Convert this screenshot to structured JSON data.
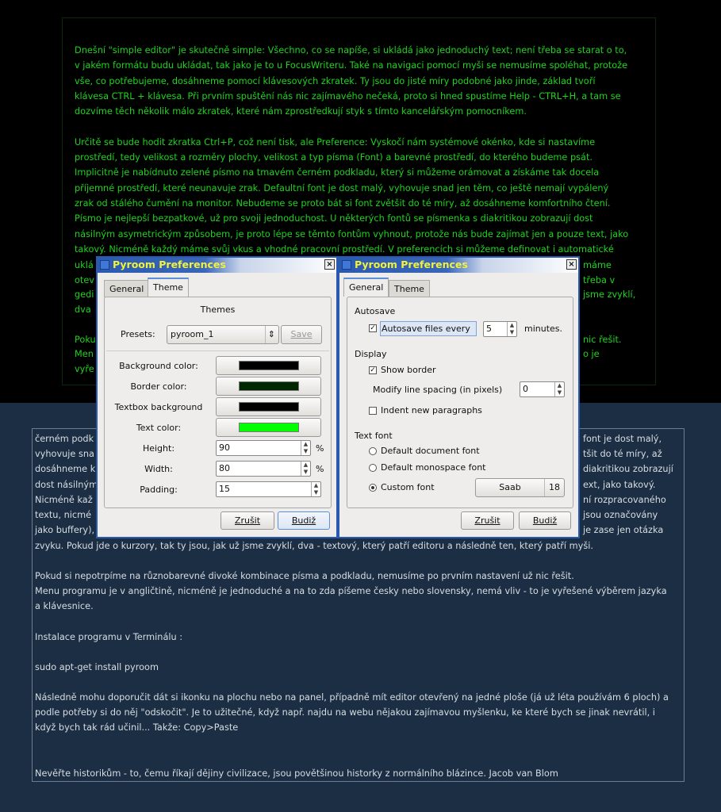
{
  "editor_top": {
    "lines": [
      "Dnešní \"simple editor\" je skutečně simple: Všechno, co se napíše, si ukládá jako jednoduchý text; není třeba se starat o to,",
      "v jakém formátu budu ukládat, tak jako je to u FocusWriteru. Také na navigaci pomocí myši se nemusíme spoléhat, protože",
      "vše, co potřebujeme, dosáhneme pomocí klávesových zkratek. Ty jsou do jisté míry podobné jako jinde, základ tvoří",
      "klávesa CTRL + klávesa. Při prvním spuštění nás nic zajímavého nečeká, proto si hned spustíme Help - CTRL+H, a tam se",
      "dozvíme těch několik málo zkratek, které nám zprostředkují styk s tímto kancelářským pomocníkem.",
      "",
      "Určitě se bude hodit zkratka Ctrl+P, což není tisk, ale Preference: Vyskočí nám systémové okénko, kde si nastavíme",
      "prostředí, tedy velikost a rozměry plochy, velikost a typ písma (Font) a barevné prostředí, do kterého budeme psát.",
      "Implicitně je nabídnuto zelené písmo na tmavém černém podkladu, který si můžeme orámovat a získáme tak docela",
      "příjemné prostředí, které neunavuje zrak. Defaultní font je dost malý, vyhovuje snad jen těm, co ještě nemají vypálený",
      "zrak od stálého čumění na monitor. Nebudeme se proto bát si font zvětšit do té míry, až dosáhneme komfortního čtení.",
      "Písmo je nejlepší bezpatkové, už pro svoji jednoduchost. U některých fontů se písmenka s diakritikou zobrazují dost",
      "násilným asymetrickým způsobem, je proto lépe se těmto fontům vyhnout, protože nás bude zajímat jen a pouze text, jako",
      "takový. Nicméně každý máme svůj vkus a vhodné pracovní prostředí. V preferencích si můžeme definovat i automatické"
    ],
    "partial_lines": [
      {
        "left": "uklá",
        "right": "máme"
      },
      {
        "left": "otev",
        "right": "třeba v"
      },
      {
        "left": "gedi",
        "right": "jsme zvyklí,"
      },
      {
        "left": "dva",
        "right": ""
      },
      {
        "left": "",
        "right": ""
      },
      {
        "left": "Poku",
        "right": "nic řešit."
      },
      {
        "left": "Men",
        "right": "o je"
      },
      {
        "left": "vyře",
        "right": ""
      }
    ]
  },
  "editor_bottom": {
    "partial_lines": [
      {
        "left": "černém podk",
        "right": "font je dost malý,"
      },
      {
        "left": "vyhovuje sna",
        "right": "tšit do té míry, až"
      },
      {
        "left": "dosáhneme k",
        "right": "diakritikou zobrazují"
      },
      {
        "left": "dost násilným",
        "right": "ext, jako takový."
      },
      {
        "left": "Nicméně kaž",
        "right": "ní rozpracovaného"
      },
      {
        "left": "textu, nicmé",
        "right": "jsou označovány"
      },
      {
        "left": "jako buffery),",
        "right": "je zase jen otázka"
      }
    ],
    "lines": [
      "zvyku. Pokud jde o kurzory, tak ty jsou, jak už jsme zvyklí, dva - textový, který patří editoru a následně ten, který patří myši.",
      "",
      "Pokud si nepotrpíme na různobarevné divoké kombinace písma a podkladu, nemusíme po prvním nastavení už nic řešit.",
      "Menu programu je v angličtině, nicméně je jednoduché a na to zda píšeme česky nebo slovensky, nemá vliv - to je vyřešené výběrem jazyka",
      "a klávesnice.",
      "",
      "Instalace programu v Terminálu :",
      "",
      "sudo apt-get install pyroom",
      "",
      "Následně mohu doporučit dát si ikonku na plochu nebo na panel, případně mít editor otevřený na jedné ploše (já už léta používám 6 ploch) a",
      "podle potřeby si do něj \"odskočit\". Je to užitečné, když např. najdu na webu nějakou zajímavou myšlenku, ke které bych se jinak nevrátil, i",
      "když bych tak rád učinil... Takže: Copy>Paste",
      "",
      "",
      "Nevěřte historikům - to, čemu říkají dějiny civilizace, jsou povětšinou historky z normálního blázince. Jacob van Blom"
    ]
  },
  "dialog_theme": {
    "title": "Pyroom Preferences",
    "close": "×",
    "tabs": [
      "General",
      "Theme"
    ],
    "active_tab": "Theme",
    "section": "Themes",
    "presets_label": "Presets:",
    "preset_value": "pyroom_1",
    "save_label": "Save",
    "colors": [
      {
        "label": "Background color:",
        "color": "#000000"
      },
      {
        "label": "Border color:",
        "color": "#002800"
      },
      {
        "label": "Textbox background",
        "color": "#000000"
      },
      {
        "label": "Text color:",
        "color": "#00ff00"
      }
    ],
    "height_label": "Height:",
    "height_value": "90",
    "width_label": "Width:",
    "width_value": "80",
    "percent": "%",
    "padding_label": "Padding:",
    "padding_value": "15",
    "cancel": "Zrušit",
    "ok": "Budiž"
  },
  "dialog_general": {
    "title": "Pyroom Preferences",
    "close": "×",
    "tabs": [
      "General",
      "Theme"
    ],
    "active_tab": "General",
    "autosave_heading": "Autosave",
    "autosave_label": "Autosave files every",
    "autosave_checked": true,
    "autosave_value": "5",
    "minutes": "minutes.",
    "display_heading": "Display",
    "show_border": "Show border",
    "show_border_checked": true,
    "line_spacing_label": "Modify line spacing (in pixels)",
    "line_spacing_value": "0",
    "indent": "Indent new paragraphs",
    "indent_checked": false,
    "font_heading": "Text font",
    "font_options": [
      "Default document font",
      "Default monospace font",
      "Custom font"
    ],
    "font_selected": "Custom font",
    "font_name": "Saab",
    "font_size": "18",
    "cancel": "Zrušit",
    "ok": "Budiž"
  },
  "colors": {
    "top_bg": "#000000",
    "text_green": "#1fd41f",
    "bottom_bg": "#1b2e43",
    "titlebar": "#2a5ab0"
  }
}
